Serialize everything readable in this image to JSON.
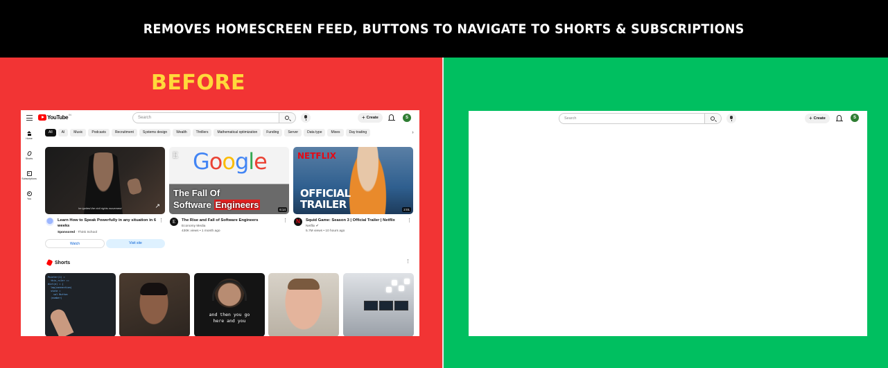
{
  "banner": {
    "headline": "REMOVES HOMESCREEN FEED, BUTTONS TO NAVIGATE TO SHORTS & SUBSCRIPTIONS"
  },
  "before": {
    "label": "BEFORE",
    "header": {
      "logo_text": "YouTube",
      "logo_sup": "IN",
      "search_placeholder": "Search",
      "create_label": "Create",
      "avatar_letter": "S"
    },
    "sidebar": [
      {
        "label": "Home",
        "icon": "home-icon"
      },
      {
        "label": "Shorts",
        "icon": "shorts-icon"
      },
      {
        "label": "Subscriptions",
        "icon": "subscriptions-icon"
      },
      {
        "label": "You",
        "icon": "you-icon"
      }
    ],
    "chips": [
      "All",
      "AI",
      "Music",
      "Podcasts",
      "Recruitment",
      "Systems design",
      "Wealth",
      "Thrillers",
      "Mathematical optimization",
      "Funding",
      "Server",
      "Data type",
      "Mixes",
      "Day trading"
    ],
    "videos": [
      {
        "title": "Learn How to Speak Powerfully in any situation in 6 weeks",
        "channel_prefix": "Sponsored",
        "channel": "Think School",
        "meta": "",
        "caption": "he ignited the civil rights movement",
        "duration": ""
      },
      {
        "title": "The Rise and Fall of Software Engineers",
        "channel": "Economy Media",
        "meta": "430K views • 1 month ago",
        "thumb_brand": "Google",
        "thumb_line1": "The Fall Of",
        "thumb_line2a": "Software",
        "thumb_line2b": "Engineers",
        "duration": "6:14"
      },
      {
        "title": "Squid Game: Season 3 | Official Trailer | Netflix",
        "channel": "Netflix ✔",
        "meta": "5.7M views • 10 hours ago",
        "thumb_brand": "NETFLIX",
        "thumb_line1": "OFFICIAL",
        "thumb_line2": "TRAILER",
        "duration": "2:01"
      }
    ],
    "ad_buttons": {
      "watch": "Watch",
      "visit": "Visit site"
    },
    "shorts_heading": "Shorts",
    "shorts_caption_line1": "and then you go",
    "shorts_caption_line2": "here and you"
  },
  "after": {
    "search_placeholder": "Search",
    "create_label": "Create",
    "avatar_letter": "S"
  },
  "colors": {
    "before_panel": "#f23434",
    "after_panel": "#00bf60",
    "before_label": "#ffd93b",
    "youtube_red": "#ff0000",
    "avatar_green": "#2e7d32"
  }
}
